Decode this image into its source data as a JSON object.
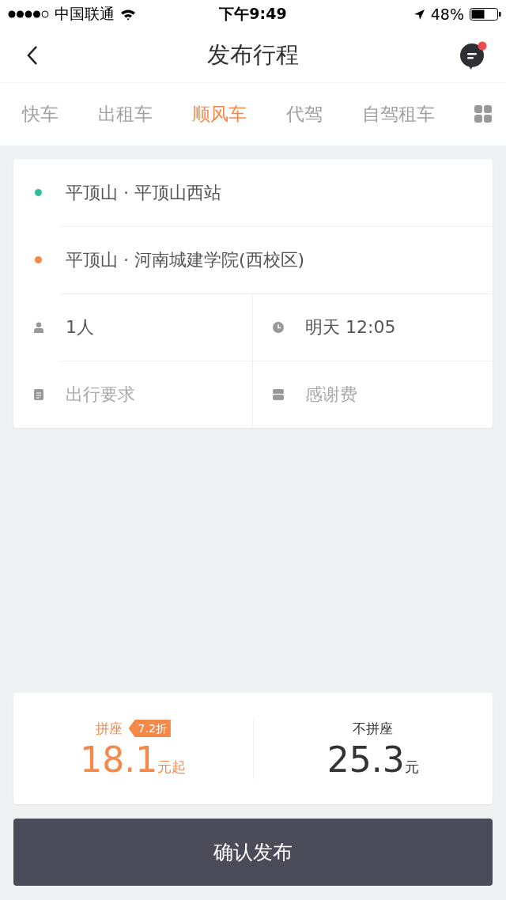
{
  "status_bar": {
    "carrier": "中国联通",
    "time": "下午9:49",
    "battery": "48%"
  },
  "nav": {
    "title": "发布行程",
    "has_unread": true
  },
  "tabs": [
    {
      "label": "快车",
      "selected": false
    },
    {
      "label": "出租车",
      "selected": false
    },
    {
      "label": "顺风车",
      "selected": true
    },
    {
      "label": "代驾",
      "selected": false
    },
    {
      "label": "自驾租车",
      "selected": false
    }
  ],
  "route": [
    {
      "text": "平顶山 · 平顶山西站",
      "color": "#2dbf9a"
    },
    {
      "text": "平顶山 · 河南城建学院(西校区)",
      "color": "#f5894a"
    }
  ],
  "options": [
    {
      "kind": "passengers",
      "value": "1人"
    },
    {
      "kind": "time",
      "value": "明天 12:05"
    },
    {
      "kind": "requirements",
      "placeholder": "出行要求"
    },
    {
      "kind": "tip",
      "placeholder": "感谢费"
    }
  ],
  "prices": [
    {
      "label": "拼座",
      "badge": "7.2折",
      "amount": "18.1",
      "unit": "元起",
      "selected": true
    },
    {
      "label": "不拼座",
      "amount": "25.3",
      "unit": "元",
      "selected": false
    }
  ],
  "confirm_button": "确认发布"
}
